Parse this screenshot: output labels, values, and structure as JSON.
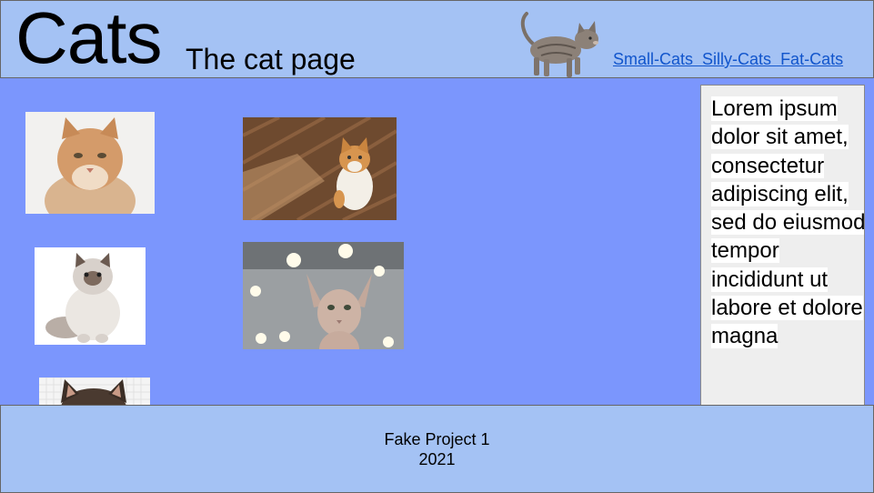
{
  "header": {
    "title": "Cats",
    "subtitle": "The cat page",
    "header_image_icon": "walking-cat-image",
    "nav": [
      "Small-Cats ",
      "Silly-Cats ",
      "Fat-Cats"
    ]
  },
  "gallery": {
    "photos": [
      {
        "name": "long-haired-orange-cat-photo"
      },
      {
        "name": "orange-white-cat-on-floor-photo"
      },
      {
        "name": "fluffy-white-persian-cat-photo"
      },
      {
        "name": "sphynx-cat-photo"
      },
      {
        "name": "cropped-cat-photo"
      }
    ]
  },
  "sidebar": {
    "text": "Lorem ipsum dolor sit amet, consectetur adipiscing elit, sed do eiusmod tempor incididunt ut labore et dolore magna"
  },
  "footer": {
    "line1": "Fake Project 1",
    "line2": "2021"
  },
  "colors": {
    "header_bg": "#a4c2f4",
    "main_bg": "#7b96fd",
    "sidebar_bg": "#eeeeee",
    "link": "#1155cc"
  }
}
